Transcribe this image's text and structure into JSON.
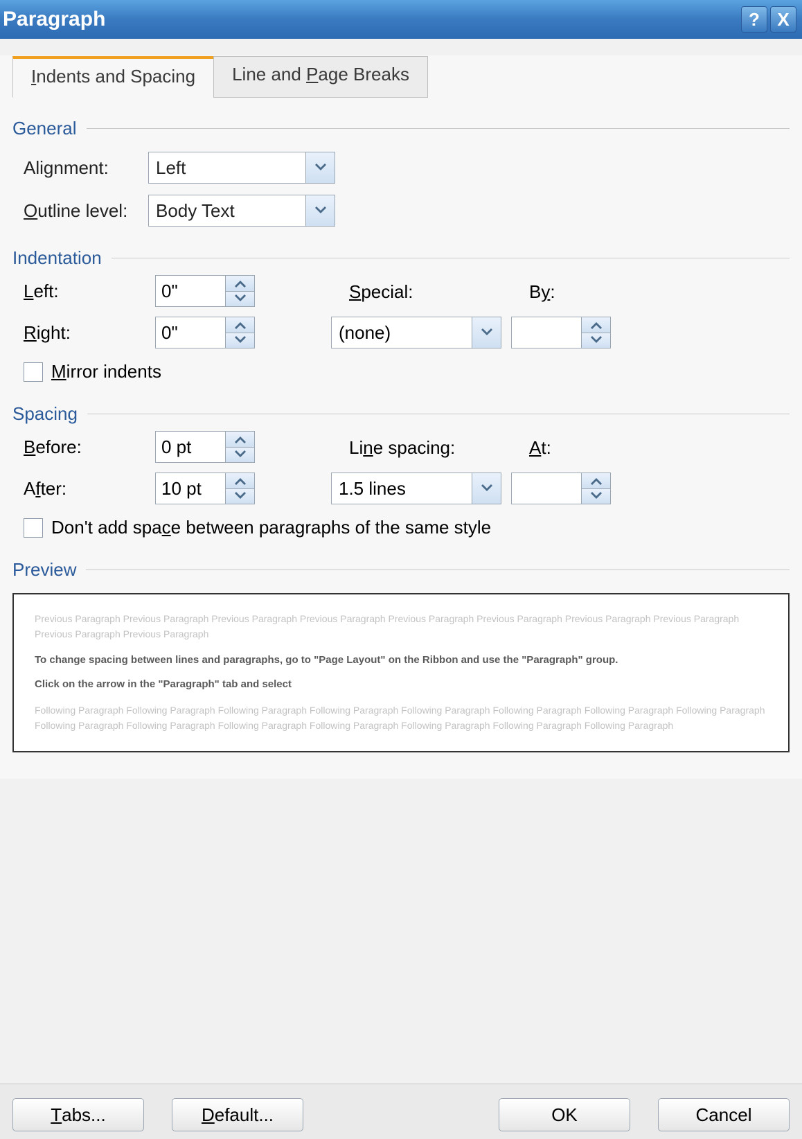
{
  "window": {
    "title": "Paragraph"
  },
  "tabs": {
    "indents": "Indents and Spacing",
    "breaks_pre": "Line and ",
    "breaks_u": "P",
    "breaks_post": "age Breaks"
  },
  "general": {
    "label": "General",
    "alignment_label": "Alignment:",
    "alignment_value": "Left",
    "outline_pre": "",
    "outline_u": "O",
    "outline_post": "utline level:",
    "outline_value": "Body Text"
  },
  "indent": {
    "label": "Indentation",
    "left_u": "L",
    "left_post": "eft:",
    "left_value": "0\"",
    "right_u": "R",
    "right_post": "ight:",
    "right_value": "0\"",
    "special_u": "S",
    "special_post": "pecial:",
    "special_value": "(none)",
    "by_pre": "B",
    "by_u": "y",
    "by_post": ":",
    "by_value": "",
    "mirror_u": "M",
    "mirror_post": "irror indents"
  },
  "spacing": {
    "label": "Spacing",
    "before_u": "B",
    "before_post": "efore:",
    "before_value": "0 pt",
    "after_pre": "A",
    "after_u": "f",
    "after_post": "ter:",
    "after_value": "10 pt",
    "ls_pre": "Li",
    "ls_u": "n",
    "ls_post": "e spacing:",
    "ls_value": "1.5 lines",
    "at_u": "A",
    "at_post": "t:",
    "at_value": "",
    "no_space_pre": "Don't add spa",
    "no_space_u": "c",
    "no_space_post": "e between paragraphs of the same style"
  },
  "preview": {
    "label": "Preview",
    "faded_top": "Previous Paragraph Previous Paragraph Previous Paragraph Previous Paragraph Previous Paragraph Previous Paragraph Previous Paragraph Previous Paragraph Previous Paragraph Previous Paragraph",
    "body1": "To change spacing between lines and paragraphs, go to \"Page Layout\" on the Ribbon and use the \"Paragraph\" group.",
    "body2": "Click on the arrow in the \"Paragraph\" tab and select",
    "faded_bottom": "Following Paragraph Following Paragraph Following Paragraph Following Paragraph Following Paragraph Following Paragraph Following Paragraph Following Paragraph Following Paragraph Following Paragraph Following Paragraph Following Paragraph Following Paragraph Following Paragraph Following Paragraph"
  },
  "buttons": {
    "tabs_u": "T",
    "tabs_post": "abs...",
    "default_u": "D",
    "default_post": "efault...",
    "ok": "OK",
    "cancel": "Cancel"
  }
}
